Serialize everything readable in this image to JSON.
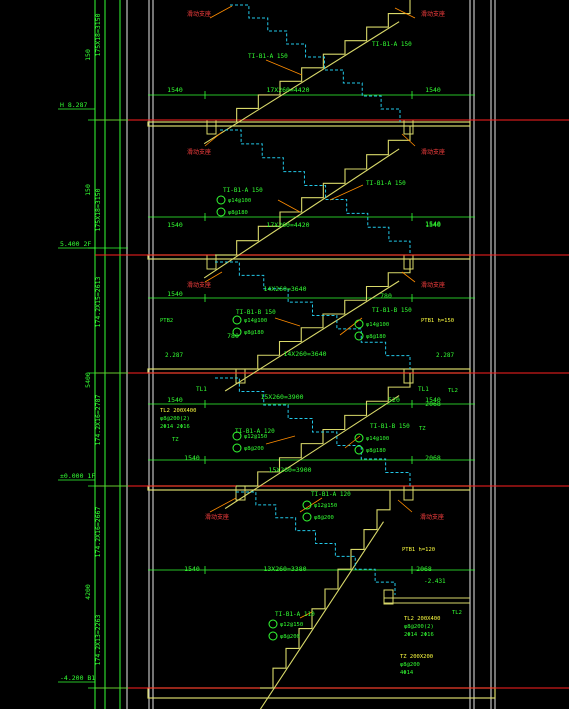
{
  "colors": {
    "background": "#000000",
    "wall": "#e8e8e8",
    "slab": "#d9d96a",
    "stair": "#d9d96a",
    "dim": "#33ff33",
    "axis": "#ff2020",
    "hidden": "#22c8e8",
    "leader": "#ff8c00",
    "label_red": "#ff4040",
    "label_green": "#33ff33",
    "label_yellow": "#ffff40"
  },
  "left_dimensions": [
    {
      "text": "150"
    },
    {
      "text": "175X18=3150"
    },
    {
      "text": "150"
    },
    {
      "text": "175X18=3150"
    },
    {
      "text": "174.2X15=2613"
    },
    {
      "text": "5400"
    },
    {
      "text": "174.2X16=2787"
    },
    {
      "text": "174.2X16=2667"
    },
    {
      "text": "4200"
    },
    {
      "text": "174.2X13=2263"
    }
  ],
  "elevations": [
    {
      "text": "H 8.287"
    },
    {
      "text": "5.400  2F"
    },
    {
      "text": "±0.000  1F"
    },
    {
      "text": "-4.200  B1"
    }
  ],
  "plan_dims": [
    {
      "text": "1540"
    },
    {
      "text": "17X260=4420"
    },
    {
      "text": "1540"
    },
    {
      "text": "1540"
    },
    {
      "text": "17X260=4420"
    },
    {
      "text": "1540"
    },
    {
      "text": "1540"
    },
    {
      "text": "14X260=3640"
    },
    {
      "text": "780"
    },
    {
      "text": "780"
    },
    {
      "text": "14X260=3640"
    },
    {
      "text": "1540"
    },
    {
      "text": "1540"
    },
    {
      "text": "15X260=3900"
    },
    {
      "text": "520"
    },
    {
      "text": "1540"
    },
    {
      "text": "2068"
    },
    {
      "text": "15X260=3900"
    },
    {
      "text": "1540"
    },
    {
      "text": "2068"
    },
    {
      "text": "13X260=3380"
    },
    {
      "text": "2068"
    },
    {
      "text": "1540"
    }
  ],
  "stair_labels": [
    {
      "text": "TI-B1-A 150"
    },
    {
      "text": "TI-B1-A 150"
    },
    {
      "text": "TI-B1-A 150"
    },
    {
      "text": "TI-B1-A 150"
    },
    {
      "text": "TI-B1-B 150"
    },
    {
      "text": "TI-B1-B 150"
    },
    {
      "text": "TI-B1-A 120"
    },
    {
      "text": "TI-B1-B 150"
    },
    {
      "text": "TI-B1-A 120"
    },
    {
      "text": "TI-B1-A 110"
    }
  ],
  "rebar_notes": [
    {
      "text": "φ14@100"
    },
    {
      "text": "φ8@180"
    },
    {
      "text": "φ14@100"
    },
    {
      "text": "φ8@180"
    },
    {
      "text": "φ14@100"
    },
    {
      "text": "φ8@180"
    },
    {
      "text": "φ12@150"
    },
    {
      "text": "φ8@200"
    },
    {
      "text": "φ14@100"
    },
    {
      "text": "φ8@180"
    },
    {
      "text": "φ12@150"
    },
    {
      "text": "φ8@200"
    },
    {
      "text": "φ12@150"
    },
    {
      "text": "φ8@200"
    }
  ],
  "beam_labels": [
    {
      "text": "TL2 200X400"
    },
    {
      "text": "φ8@200(2)"
    },
    {
      "text": "2Φ14 2Φ16"
    },
    {
      "text": "TZ"
    },
    {
      "text": "TZ"
    },
    {
      "text": "TL2"
    },
    {
      "text": "PTB2"
    },
    {
      "text": "PTB1  h=150"
    },
    {
      "text": "PTB1  h=120"
    },
    {
      "text": "TL2 200X400"
    },
    {
      "text": "φ8@200(2)"
    },
    {
      "text": "2Φ14 2Φ16"
    },
    {
      "text": "TL2"
    },
    {
      "text": "TZ 200X200"
    },
    {
      "text": "φ8@200"
    },
    {
      "text": "4Φ14"
    }
  ],
  "side_labels": [
    {
      "text": "2.287"
    },
    {
      "text": "2.287"
    },
    {
      "text": "-2.431"
    },
    {
      "text": "TL1"
    },
    {
      "text": "TL1"
    }
  ],
  "tags": [
    {
      "text": "滑动支座"
    },
    {
      "text": "滑动支座"
    },
    {
      "text": "滑动支座"
    },
    {
      "text": "滑动支座"
    },
    {
      "text": "滑动支座"
    },
    {
      "text": "滑动支座"
    },
    {
      "text": "滑动支座"
    },
    {
      "text": "滑动支座"
    }
  ]
}
